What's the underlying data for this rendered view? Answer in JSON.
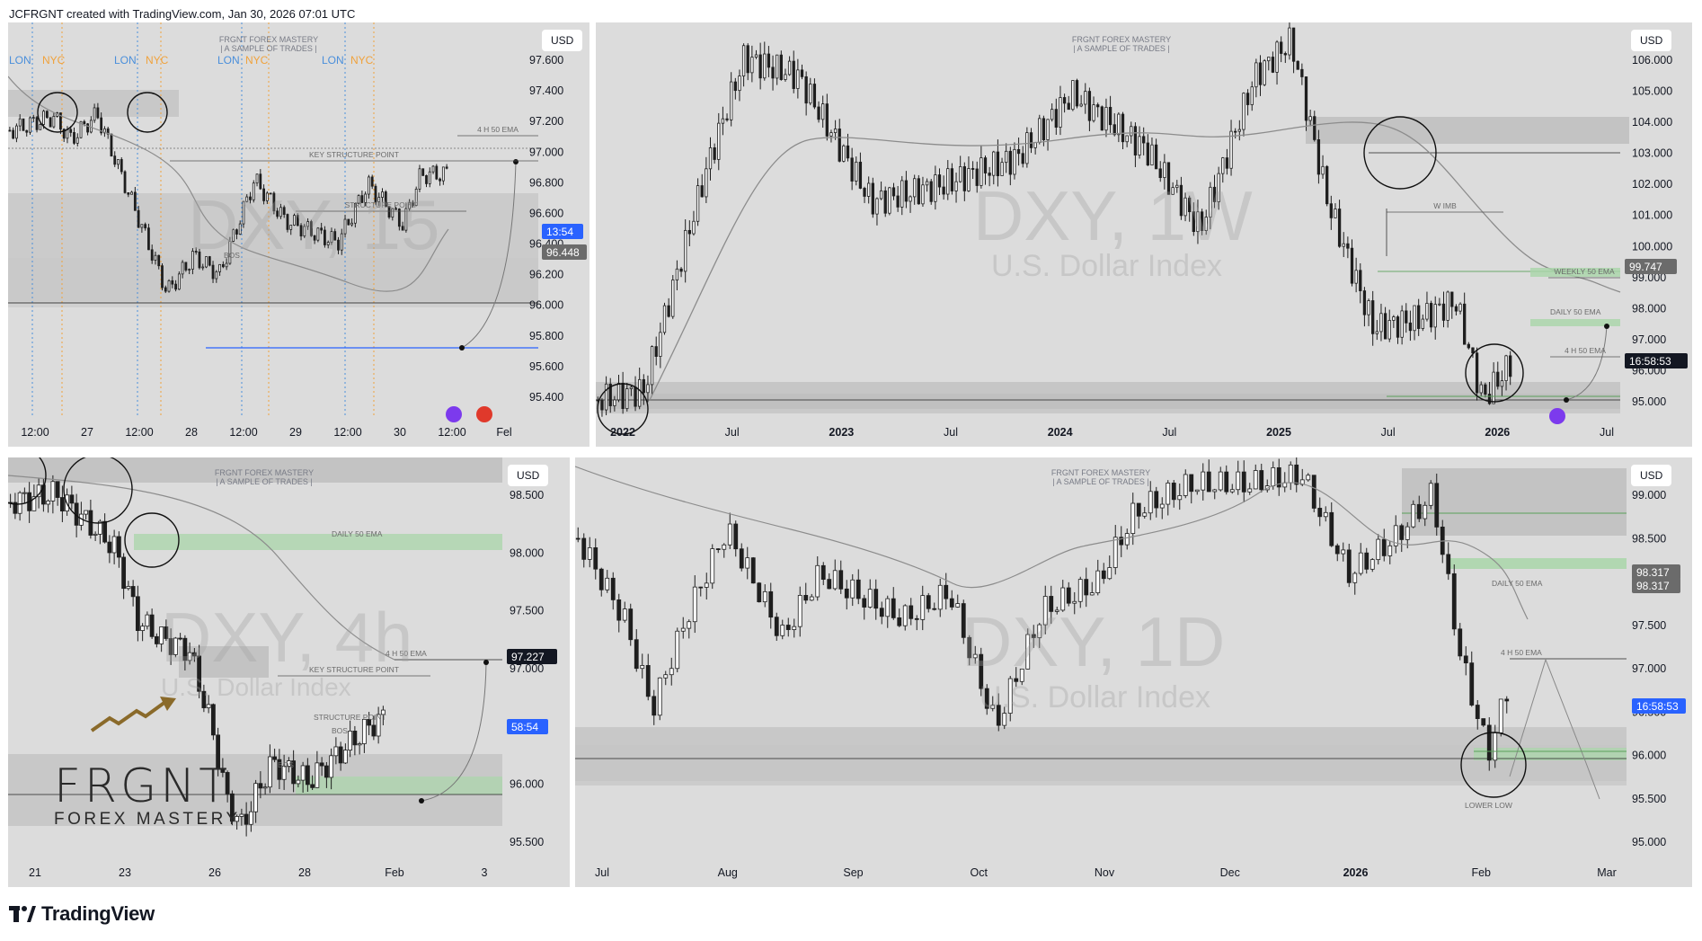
{
  "header": {
    "attribution": "JCFRGNT created with TradingView.com, Jan 30, 2026 07:01 UTC"
  },
  "footer": {
    "brand": "TradingView"
  },
  "logo": {
    "main": "FRGNT",
    "sub": "FOREX MASTERY"
  },
  "colors": {
    "panel_bg": "#dcdcdc",
    "candle": "#1e1e1e",
    "ema": "#8c8c8c",
    "zone": "#c3c3c3",
    "green_zone": "#a9d6a9",
    "lon": "#4a8fdb",
    "nyc": "#f0a23c",
    "price_blue": "#2962ff",
    "label_dark": "#131722",
    "label_gray": "#6b6b6b"
  },
  "chart_data": [
    {
      "id": "p1",
      "type": "line",
      "title": "DXY, 15",
      "subtitle": "U.S. Dollar Index",
      "watermark": [
        "FRGNT FOREX MASTERY",
        "| A SAMPLE OF TRADES |"
      ],
      "currency": "USD",
      "y_ticks": [
        "97.600",
        "97.400",
        "97.200",
        "97.000",
        "96.800",
        "96.600",
        "96.400",
        "96.200",
        "96.000",
        "95.800",
        "95.600",
        "95.400"
      ],
      "x_ticks": [
        "12:00",
        "27",
        "12:00",
        "28",
        "12:00",
        "29",
        "12:00",
        "30",
        "12:00",
        "Fel"
      ],
      "session_labels": [
        "LON",
        "NYC"
      ],
      "annotations": [
        "4 H 50 EMA",
        "KEY STRUCTURE POINT",
        "STRUCTURE POINT",
        "BOS"
      ],
      "price_labels": [
        {
          "text": "13:54",
          "kind": "blue"
        },
        {
          "text": "96.448",
          "kind": "gray"
        }
      ],
      "ylim": [
        95.35,
        97.75
      ]
    },
    {
      "id": "p2",
      "type": "line",
      "title": "DXY, 1W",
      "subtitle": "U.S. Dollar Index",
      "watermark": [
        "FRGNT FOREX MASTERY",
        "| A SAMPLE OF TRADES |"
      ],
      "currency": "USD",
      "y_ticks": [
        "106.000",
        "105.000",
        "104.000",
        "103.000",
        "102.000",
        "101.000",
        "100.000",
        "99.000",
        "98.000",
        "97.000",
        "96.000",
        "95.000"
      ],
      "x_ticks": [
        "2022",
        "Jul",
        "2023",
        "Jul",
        "2024",
        "Jul",
        "2025",
        "Jul",
        "2026",
        "Jul"
      ],
      "annotations": [
        "W IMB",
        "WEEKLY 50 EMA",
        "DAILY 50 EMA",
        "4 H 50 EMA"
      ],
      "price_labels": [
        {
          "text": "99.747",
          "kind": "gray"
        },
        {
          "text": "16:58:53",
          "kind": "dark"
        }
      ],
      "ylim": [
        94.5,
        107.2
      ]
    },
    {
      "id": "p3",
      "type": "line",
      "title": "DXY, 4h",
      "subtitle": "U.S. Dollar Index",
      "watermark": [
        "FRGNT FOREX MASTERY",
        "| A SAMPLE OF TRADES |"
      ],
      "currency": "USD",
      "y_ticks": [
        "98.500",
        "98.000",
        "97.500",
        "97.000",
        "96.500",
        "96.000",
        "95.500"
      ],
      "x_ticks": [
        "21",
        "23",
        "26",
        "28",
        "Feb",
        "3"
      ],
      "annotations": [
        "DAILY 50 EMA",
        "4 H 50 EMA",
        "KEY STRUCTURE POINT",
        "STRUCTURE POINT",
        "BOS",
        "BOS"
      ],
      "price_labels": [
        {
          "text": "97.227",
          "kind": "dark"
        },
        {
          "text": "58:54",
          "kind": "blue"
        }
      ],
      "ylim": [
        95.3,
        99.0
      ]
    },
    {
      "id": "p4",
      "type": "line",
      "title": "DXY, 1D",
      "subtitle": "U.S. Dollar Index",
      "watermark": [
        "FRGNT FOREX MASTERY",
        "| A SAMPLE OF TRADES |"
      ],
      "currency": "USD",
      "y_ticks": [
        "99.000",
        "98.500",
        "98.000",
        "97.500",
        "97.000",
        "96.500",
        "96.000",
        "95.500",
        "95.000"
      ],
      "x_ticks": [
        "Jul",
        "Aug",
        "Sep",
        "Oct",
        "Nov",
        "Dec",
        "2026",
        "Feb",
        "Mar"
      ],
      "annotations": [
        "DAILY 50 EMA",
        "4 H 50 EMA",
        "LOWER LOW"
      ],
      "price_labels": [
        {
          "text": "98.317",
          "kind": "gray"
        },
        {
          "text": "98.317",
          "kind": "gray"
        },
        {
          "text": "16:58:53",
          "kind": "blue"
        }
      ],
      "ylim": [
        94.8,
        99.4
      ]
    }
  ]
}
